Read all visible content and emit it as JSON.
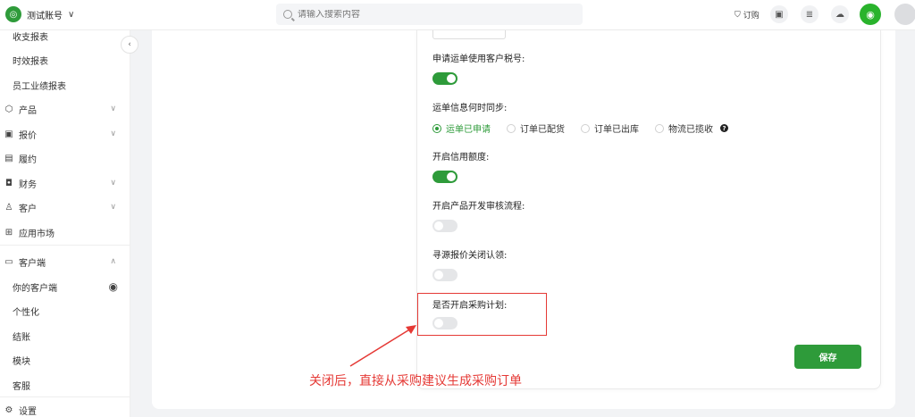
{
  "topbar": {
    "account_name": "测试账号",
    "search_placeholder": "请输入搜索内容",
    "order_label": "订购"
  },
  "sidebar": {
    "items": [
      {
        "label": "收支报表",
        "type": "sub"
      },
      {
        "label": "时效报表",
        "type": "sub"
      },
      {
        "label": "员工业绩报表",
        "type": "sub"
      },
      {
        "label": "产品",
        "icon": "cube-icon",
        "has_chevron": true
      },
      {
        "label": "报价",
        "icon": "quote-icon",
        "has_chevron": true
      },
      {
        "label": "履约",
        "icon": "fulfillment-icon",
        "has_chevron": false
      },
      {
        "label": "财务",
        "icon": "wallet-icon",
        "has_chevron": true
      },
      {
        "label": "客户",
        "icon": "customer-icon",
        "has_chevron": true
      },
      {
        "label": "应用市场",
        "icon": "apps-icon",
        "has_chevron": false
      },
      {
        "label": "客户端",
        "icon": "monitor-icon",
        "expanded": true
      },
      {
        "label": "你的客户端",
        "type": "sub",
        "has_eye": true
      },
      {
        "label": "个性化",
        "type": "sub"
      },
      {
        "label": "结账",
        "type": "sub"
      },
      {
        "label": "模块",
        "type": "sub"
      },
      {
        "label": "客服",
        "type": "sub"
      },
      {
        "label": "设置",
        "icon": "settings-icon"
      }
    ]
  },
  "settings": {
    "tax_id_label": "申请运单使用客户税号:",
    "tax_id_enabled": true,
    "sync_label": "运单信息何时同步:",
    "sync_options": [
      "运单已申请",
      "订单已配货",
      "订单已出库",
      "物流已揽收"
    ],
    "sync_selected": "运单已申请",
    "credit_label": "开启信用额度:",
    "credit_enabled": true,
    "review_label": "开启产品开发审核流程:",
    "review_enabled": false,
    "sourcing_label": "寻源报价关闭认领:",
    "sourcing_enabled": false,
    "purchase_plan_label": "是否开启采购计划:",
    "purchase_plan_enabled": false,
    "save_label": "保存"
  },
  "annotation": {
    "text": "关闭后，直接从采购建议生成采购订单",
    "color": "#e53935"
  },
  "colors": {
    "accent": "#2e9b3a",
    "toggle_off": "#e5e6e8"
  }
}
